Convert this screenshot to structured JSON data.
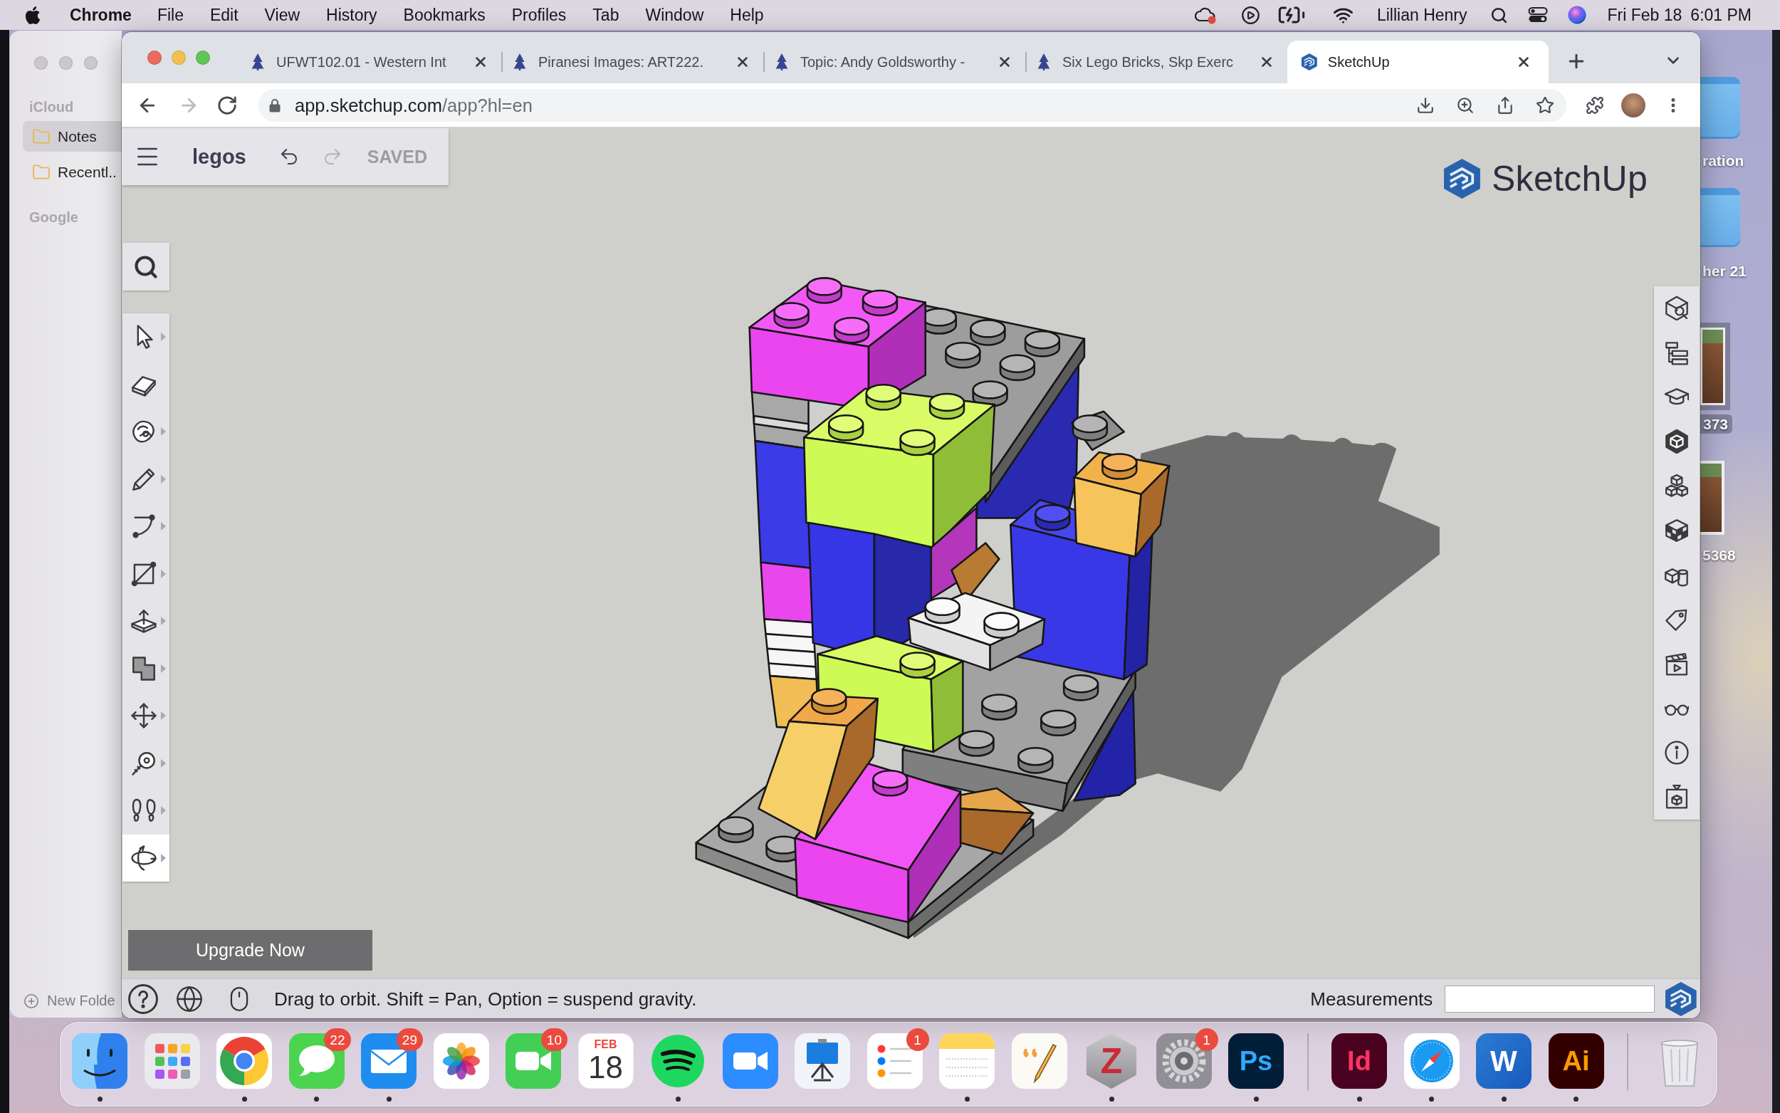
{
  "menu_bar": {
    "app": "Chrome",
    "menus": [
      "File",
      "Edit",
      "View",
      "History",
      "Bookmarks",
      "Profiles",
      "Tab",
      "Window",
      "Help"
    ],
    "user": "Lillian Henry",
    "date": "Fri Feb 18",
    "time": "6:01 PM"
  },
  "desktop_items": [
    {
      "kind": "folder",
      "label": "ration",
      "selected": false
    },
    {
      "kind": "folder",
      "label": "her 21",
      "selected": false
    },
    {
      "kind": "photo",
      "label": "373",
      "selected": true
    },
    {
      "kind": "photo",
      "label": "5368",
      "selected": false
    }
  ],
  "notes_window": {
    "sections": [
      {
        "title": "iCloud",
        "folders": [
          {
            "label": "Notes",
            "selected": true
          },
          {
            "label": "Recentl..",
            "selected": false
          }
        ]
      },
      {
        "title": "Google"
      }
    ],
    "new_folder": "New Folde"
  },
  "browser": {
    "tabs": [
      {
        "kind": "tree",
        "title": "UFWT102.01 - Western Int",
        "selected": false
      },
      {
        "kind": "tree",
        "title": "Piranesi Images: ART222.",
        "selected": false
      },
      {
        "kind": "tree",
        "title": "Topic: Andy Goldsworthy -",
        "selected": false
      },
      {
        "kind": "tree",
        "title": "Six Lego Bricks, Skp Exerc",
        "selected": false
      },
      {
        "kind": "cube",
        "title": "SketchUp",
        "selected": true
      }
    ],
    "nav_buttons": [
      {
        "kind": "back",
        "disabled": false
      },
      {
        "kind": "forward",
        "disabled": true
      },
      {
        "kind": "reload",
        "disabled": false
      }
    ],
    "url": {
      "host": "app.sketchup.com",
      "path": "/app?hl=en"
    }
  },
  "sketchup": {
    "file_bar": {
      "title": "legos",
      "history_buttons": [
        {
          "kind": "undo",
          "disabled": false
        },
        {
          "kind": "redo",
          "disabled": true
        }
      ],
      "save_status": "SAVED"
    },
    "logo": "SketchUp",
    "tools": [
      {
        "kind": "select",
        "flyout": true,
        "selected": false
      },
      {
        "kind": "eraser",
        "flyout": false,
        "selected": false
      },
      {
        "kind": "paint",
        "flyout": true,
        "selected": false
      },
      {
        "kind": "pencil",
        "flyout": true,
        "selected": false
      },
      {
        "kind": "arc",
        "flyout": true,
        "selected": false
      },
      {
        "kind": "rectangle",
        "flyout": true,
        "selected": false
      },
      {
        "kind": "pushpull",
        "flyout": true,
        "selected": false
      },
      {
        "kind": "offset",
        "flyout": true,
        "selected": false
      },
      {
        "kind": "move",
        "flyout": true,
        "selected": false
      },
      {
        "kind": "tape",
        "flyout": true,
        "selected": false
      },
      {
        "kind": "walk",
        "flyout": true,
        "selected": false
      },
      {
        "kind": "orbit",
        "flyout": true,
        "selected": true
      }
    ],
    "panels": [
      {
        "kind": "inspect"
      },
      {
        "kind": "outliner"
      },
      {
        "kind": "instructor"
      },
      {
        "kind": "materials"
      },
      {
        "kind": "components"
      },
      {
        "kind": "styles"
      },
      {
        "kind": "solids"
      },
      {
        "kind": "tags"
      },
      {
        "kind": "scenes"
      },
      {
        "kind": "display"
      },
      {
        "kind": "info"
      },
      {
        "kind": "warehouse"
      }
    ],
    "upgrade_button": "Upgrade Now",
    "status_bar": {
      "hint": "Drag to orbit. Shift = Pan, Option = suspend gravity.",
      "measurements_label": "Measurements"
    }
  },
  "dock": {
    "apps": [
      {
        "kind": "finder",
        "running": true
      },
      {
        "kind": "launchpad",
        "running": false
      },
      {
        "kind": "chrome",
        "running": true
      },
      {
        "kind": "messages",
        "running": true,
        "badge": "22"
      },
      {
        "kind": "mail",
        "running": true,
        "badge": "29"
      },
      {
        "kind": "photos",
        "running": false
      },
      {
        "kind": "facetime",
        "running": false,
        "badge": "10"
      },
      {
        "kind": "calendar",
        "running": false,
        "month": "FEB",
        "day": "18"
      },
      {
        "kind": "spotify",
        "running": true
      },
      {
        "kind": "zoom",
        "running": false
      },
      {
        "kind": "keynote",
        "running": false
      },
      {
        "kind": "reminders",
        "running": false,
        "badge": "1"
      },
      {
        "kind": "notes",
        "running": true
      },
      {
        "kind": "pages",
        "running": false
      },
      {
        "kind": "zotero",
        "running": true,
        "glyph": "Z"
      },
      {
        "kind": "settings",
        "running": false,
        "badge": "1"
      },
      {
        "kind": "photoshop",
        "running": true,
        "glyph": "Ps"
      },
      {
        "kind": "separator"
      },
      {
        "kind": "indesign",
        "running": true,
        "glyph": "Id"
      },
      {
        "kind": "safari",
        "running": true
      },
      {
        "kind": "word",
        "running": true,
        "glyph": "W"
      },
      {
        "kind": "illustrator",
        "running": true,
        "glyph": "Ai"
      },
      {
        "kind": "separator"
      },
      {
        "kind": "trash",
        "running": false
      }
    ]
  }
}
